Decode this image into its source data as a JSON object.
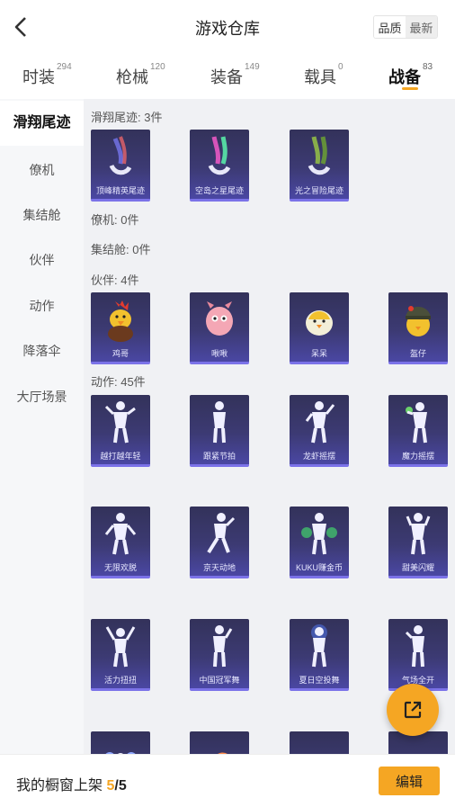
{
  "header": {
    "title": "游戏仓库",
    "sort_options": [
      "品质",
      "最新"
    ]
  },
  "tabs": [
    {
      "label": "时装",
      "count": "294"
    },
    {
      "label": "枪械",
      "count": "120"
    },
    {
      "label": "装备",
      "count": "149"
    },
    {
      "label": "载具",
      "count": "0"
    },
    {
      "label": "战备",
      "count": "83"
    }
  ],
  "sidebar": {
    "items": [
      "滑翔尾迹",
      "僚机",
      "集结舱",
      "伙伴",
      "动作",
      "降落伞",
      "大厅场景"
    ]
  },
  "sections": {
    "glide_trail": {
      "title": "滑翔尾迹: 3件",
      "items": [
        "顶峰精英尾迹",
        "空岛之星尾迹",
        "光之冒险尾迹"
      ]
    },
    "wingman": {
      "title": "僚机: 0件"
    },
    "gathering_pod": {
      "title": "集结舱: 0件"
    },
    "partner": {
      "title": "伙伴: 4件",
      "items": [
        "鸡哥",
        "啾啾",
        "呆呆",
        "盔仔"
      ]
    },
    "emote": {
      "title": "动作: 45件",
      "items": [
        "越打越年轻",
        "跟紧节拍",
        "龙虾摇摆",
        "魔力摇摆",
        "无限欢脱",
        "京天动地",
        "KUKU赚金币",
        "甜美闪耀",
        "活力扭扭",
        "中国冠军舞",
        "夏日空投舞",
        "气场全开"
      ]
    }
  },
  "bottom_bar": {
    "label": "我的橱窗上架",
    "current": "5",
    "separator": "/",
    "total": "5",
    "edit_label": "编辑"
  },
  "colors": {
    "accent": "#f5a623",
    "card_bg": "#3c3a73",
    "card_border": "#7b72e8"
  },
  "icons": [
    "back-arrow-icon",
    "share-icon"
  ]
}
